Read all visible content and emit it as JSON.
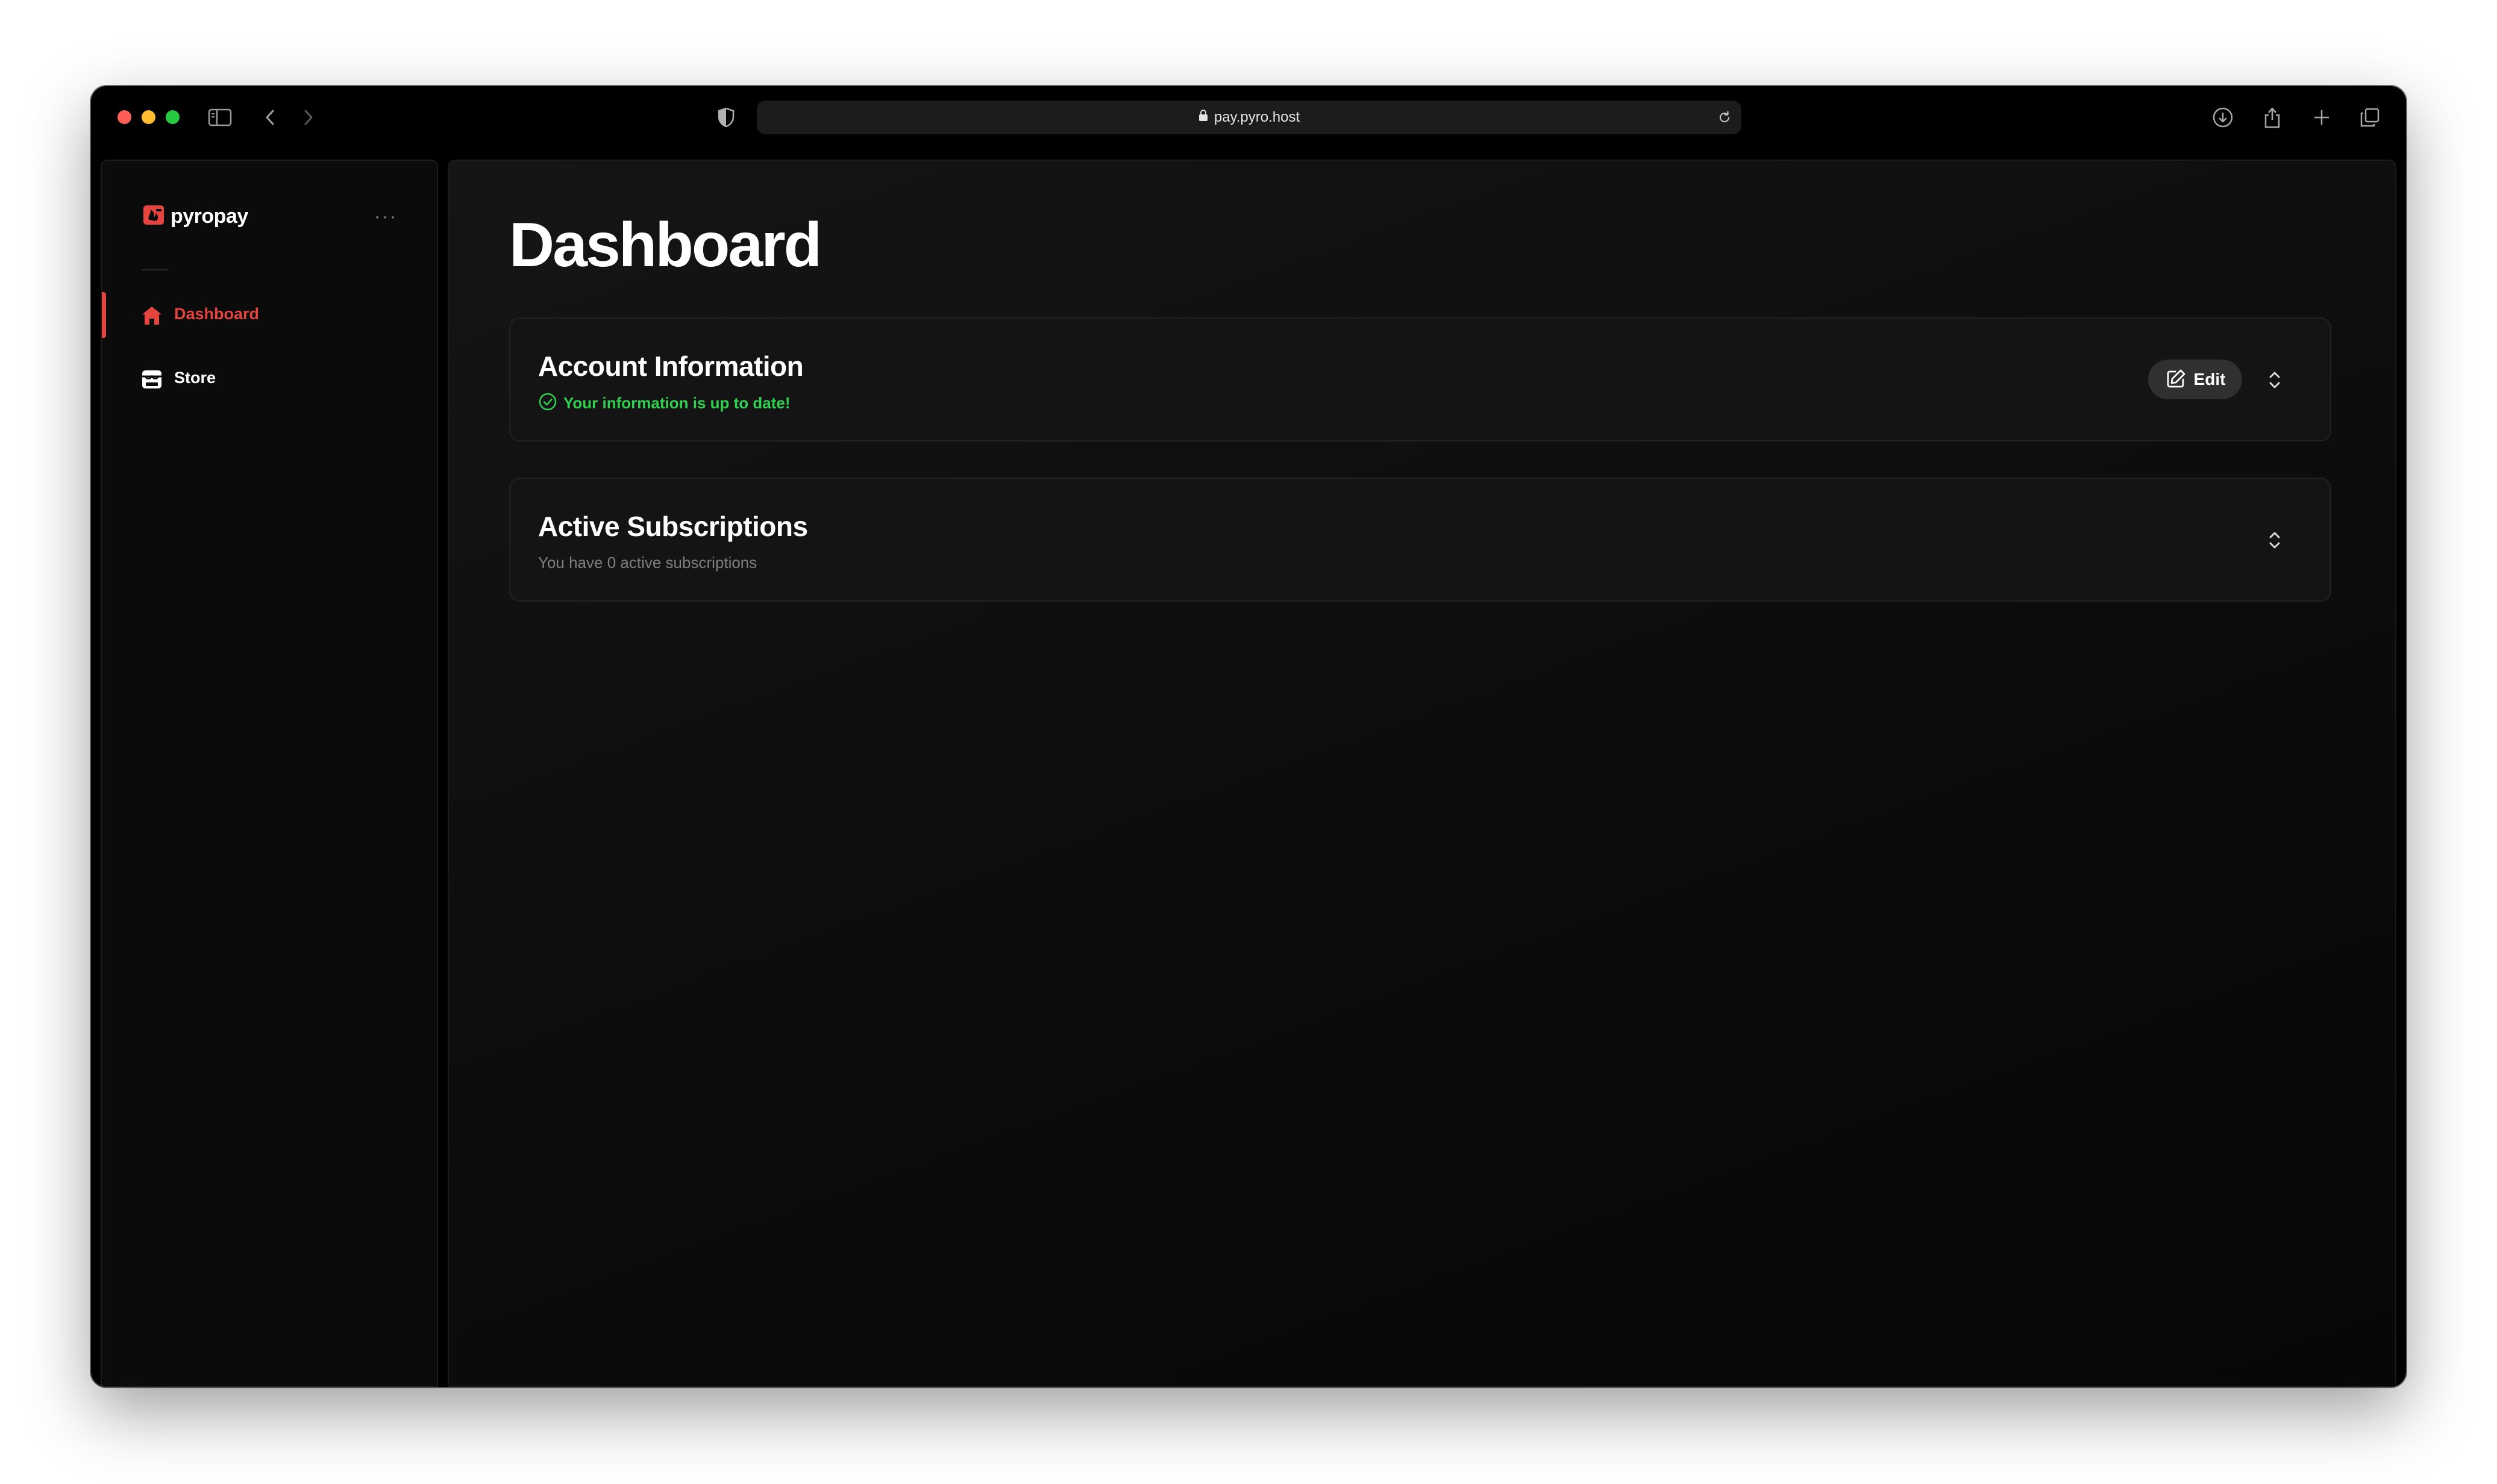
{
  "browser": {
    "url": "pay.pyro.host",
    "traffic_lights": {
      "close": "#ff5f57",
      "minimize": "#febc2e",
      "zoom": "#28c840"
    }
  },
  "colors": {
    "accent": "#e5453e",
    "success": "#2fcf4f",
    "background": "#0b0b0b"
  },
  "sidebar": {
    "brand": "pyropay",
    "items": [
      {
        "label": "Dashboard",
        "icon": "house-icon",
        "active": true
      },
      {
        "label": "Store",
        "icon": "store-icon",
        "active": false
      }
    ]
  },
  "main": {
    "title": "Dashboard",
    "cards": [
      {
        "title": "Account Information",
        "status": "Your information is up to date!",
        "edit_label": "Edit"
      },
      {
        "title": "Active Subscriptions",
        "subtitle": "You have 0 active subscriptions"
      }
    ]
  }
}
